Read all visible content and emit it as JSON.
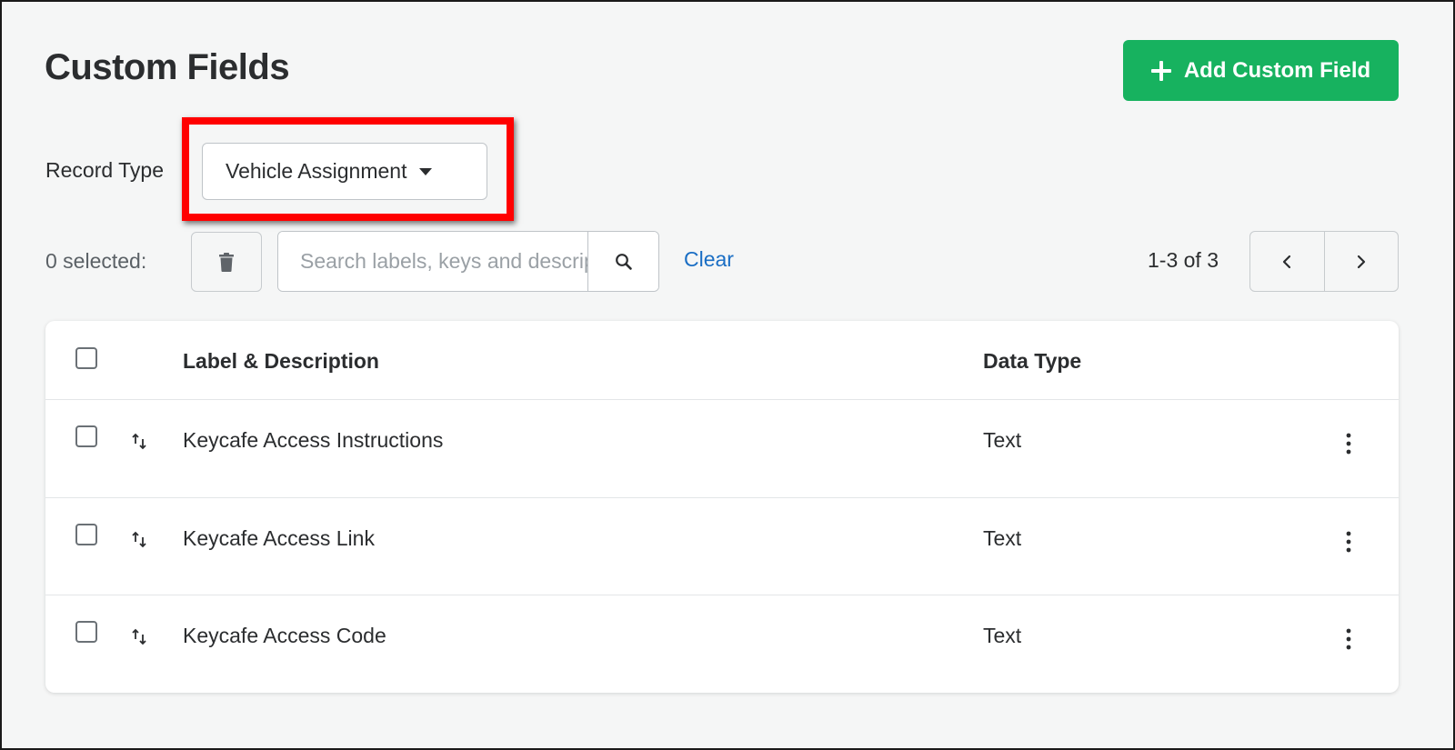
{
  "page": {
    "title": "Custom Fields",
    "add_button_label": "Add Custom Field"
  },
  "record_type": {
    "label": "Record Type",
    "selected": "Vehicle Assignment"
  },
  "toolbar": {
    "selected_count_text": "0 selected:",
    "search_placeholder": "Search labels, keys and descriptions",
    "clear_label": "Clear",
    "pagination_text": "1-3 of 3"
  },
  "table": {
    "columns": {
      "label": "Label & Description",
      "data_type": "Data Type"
    },
    "rows": [
      {
        "label": "Keycafe Access Instructions",
        "data_type": "Text"
      },
      {
        "label": "Keycafe Access Link",
        "data_type": "Text"
      },
      {
        "label": "Keycafe Access Code",
        "data_type": "Text"
      }
    ]
  },
  "colors": {
    "primary_green": "#17b25f",
    "link_blue": "#1a6ec4",
    "highlight_red": "#ff0000"
  },
  "icons": [
    "plus-icon",
    "caret-down-icon",
    "trash-icon",
    "search-icon",
    "chevron-left-icon",
    "chevron-right-icon",
    "drag-sort-icon",
    "more-vertical-icon"
  ]
}
